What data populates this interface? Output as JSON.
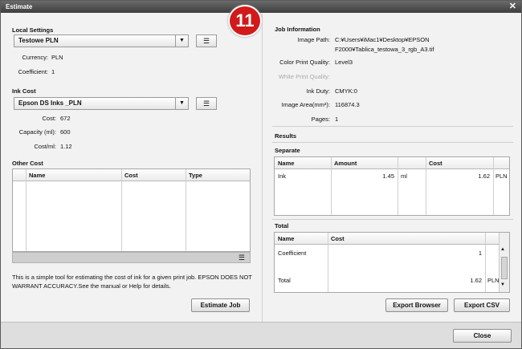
{
  "window": {
    "title": "Estimate",
    "close_glyph": "✕"
  },
  "badge": "11",
  "local_settings": {
    "heading": "Local Settings",
    "selected": "Testowe PLN",
    "currency_label": "Currency:",
    "currency_value": "PLN",
    "coefficient_label": "Coefficient:",
    "coefficient_value": "1"
  },
  "ink_cost": {
    "heading": "Ink Cost",
    "selected": "Epson DS Inks _PLN",
    "cost_label": "Cost:",
    "cost_value": "672",
    "capacity_label": "Capacity (ml):",
    "capacity_value": "600",
    "costml_label": "Cost/ml:",
    "costml_value": "1.12"
  },
  "other_cost": {
    "heading": "Other Cost",
    "columns": [
      "Name",
      "Cost",
      "Type"
    ]
  },
  "note": "This is a simple tool for estimating the cost of ink for a given print job. EPSON DOES NOT WARRANT ACCURACY.See the manual or Help for details.",
  "buttons": {
    "estimate": "Estimate Job",
    "export_browser": "Export Browser",
    "export_csv": "Export CSV",
    "close": "Close"
  },
  "job_info": {
    "heading": "Job Information",
    "image_path_label": "Image Path:",
    "image_path_line1": "C:¥Users¥iMac1¥Desktop¥EPSON",
    "image_path_line2": "F2000¥Tablica_testowa_3_rgb_A3.tif",
    "color_quality_label": "Color Print Quality:",
    "color_quality_value": "Level3",
    "white_quality_label": "White Print Quality:",
    "ink_duty_label": "Ink Duty:",
    "ink_duty_value": "CMYK:0",
    "image_area_label": "Image Area(mm²):",
    "image_area_value": "116874.3",
    "pages_label": "Pages:",
    "pages_value": "1"
  },
  "results": {
    "heading": "Results",
    "separate": {
      "heading": "Separate",
      "columns": [
        "Name",
        "Amount",
        "",
        "Cost",
        ""
      ],
      "row": {
        "name": "Ink",
        "amount": "1.45",
        "unit": "ml",
        "cost": "1.62",
        "currency": "PLN"
      }
    },
    "total": {
      "heading": "Total",
      "columns": [
        "Name",
        "Cost"
      ],
      "rows": [
        {
          "name": "Coefficient",
          "cost": "1",
          "currency": ""
        },
        {
          "name": "Total",
          "cost": "1.62",
          "currency": "PLN"
        }
      ]
    }
  },
  "icons": {
    "list": "list-icon",
    "dropdown": "chevron-down-icon"
  }
}
